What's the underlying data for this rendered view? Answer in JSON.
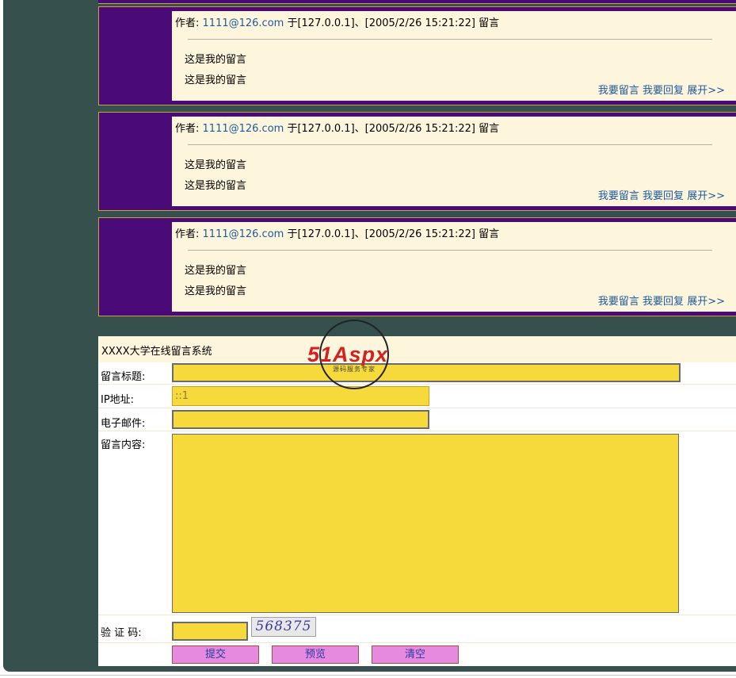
{
  "posts": [
    {
      "author_label": "作者:",
      "email": "1111@126.com",
      "meta": "于[127.0.0.1]、[2005/2/26 15:21:22] 留言",
      "lines": [
        "这是我的留言",
        "这是我的留言"
      ],
      "links": {
        "leave_message": "我要留言",
        "reply": "我要回复",
        "expand": "展开>>"
      }
    },
    {
      "author_label": "作者:",
      "email": "1111@126.com",
      "meta": "于[127.0.0.1]、[2005/2/26 15:21:22] 留言",
      "lines": [
        "这是我的留言",
        "这是我的留言"
      ],
      "links": {
        "leave_message": "我要留言",
        "reply": "我要回复",
        "expand": "展开>>"
      }
    },
    {
      "author_label": "作者:",
      "email": "1111@126.com",
      "meta": "于[127.0.0.1]、[2005/2/26 15:21:22] 留言",
      "lines": [
        "这是我的留言",
        "这是我的留言"
      ],
      "links": {
        "leave_message": "我要留言",
        "reply": "我要回复",
        "expand": "展开>>"
      }
    }
  ],
  "form": {
    "title": "XXXX大学在线留言系统",
    "subject_label": "留言标题:",
    "subject_value": "",
    "ip_label": "IP地址:",
    "ip_value": "::1",
    "email_label": "电子邮件:",
    "email_value": "",
    "content_label": "留言内容:",
    "content_value": "",
    "captcha_label": "验 证 码:",
    "captcha_value": "",
    "captcha_image_text": "568375",
    "buttons": {
      "submit": "提交",
      "preview": "预览",
      "clear": "清空"
    }
  },
  "watermark": {
    "brand": "51Aspx",
    "tagline": "源码服务专家"
  },
  "colors": {
    "page_background": "#36504e",
    "post_background": "#4a0a78",
    "post_content_background": "#fdf5dc",
    "link": "#1e5aa0",
    "field_background": "#f6d93a",
    "button_background": "#e68ae0",
    "logo_red": "#d42020",
    "logo_green": "#3aa030"
  }
}
